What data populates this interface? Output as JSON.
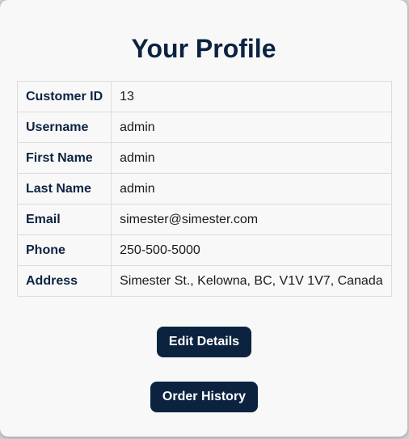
{
  "page": {
    "title": "Your Profile"
  },
  "profile": {
    "rows": [
      {
        "label": "Customer ID",
        "value": "13"
      },
      {
        "label": "Username",
        "value": "admin"
      },
      {
        "label": "First Name",
        "value": "admin"
      },
      {
        "label": "Last Name",
        "value": "admin"
      },
      {
        "label": "Email",
        "value": "simester@simester.com"
      },
      {
        "label": "Phone",
        "value": "250-500-5000"
      },
      {
        "label": "Address",
        "value": "Simester St., Kelowna, BC, V1V 1V7, Canada"
      }
    ]
  },
  "actions": {
    "edit_label": "Edit Details",
    "orders_label": "Order History"
  },
  "colors": {
    "primary": "#0c2340",
    "card_background": "#f8f8f9",
    "border": "#dcdcdc"
  }
}
